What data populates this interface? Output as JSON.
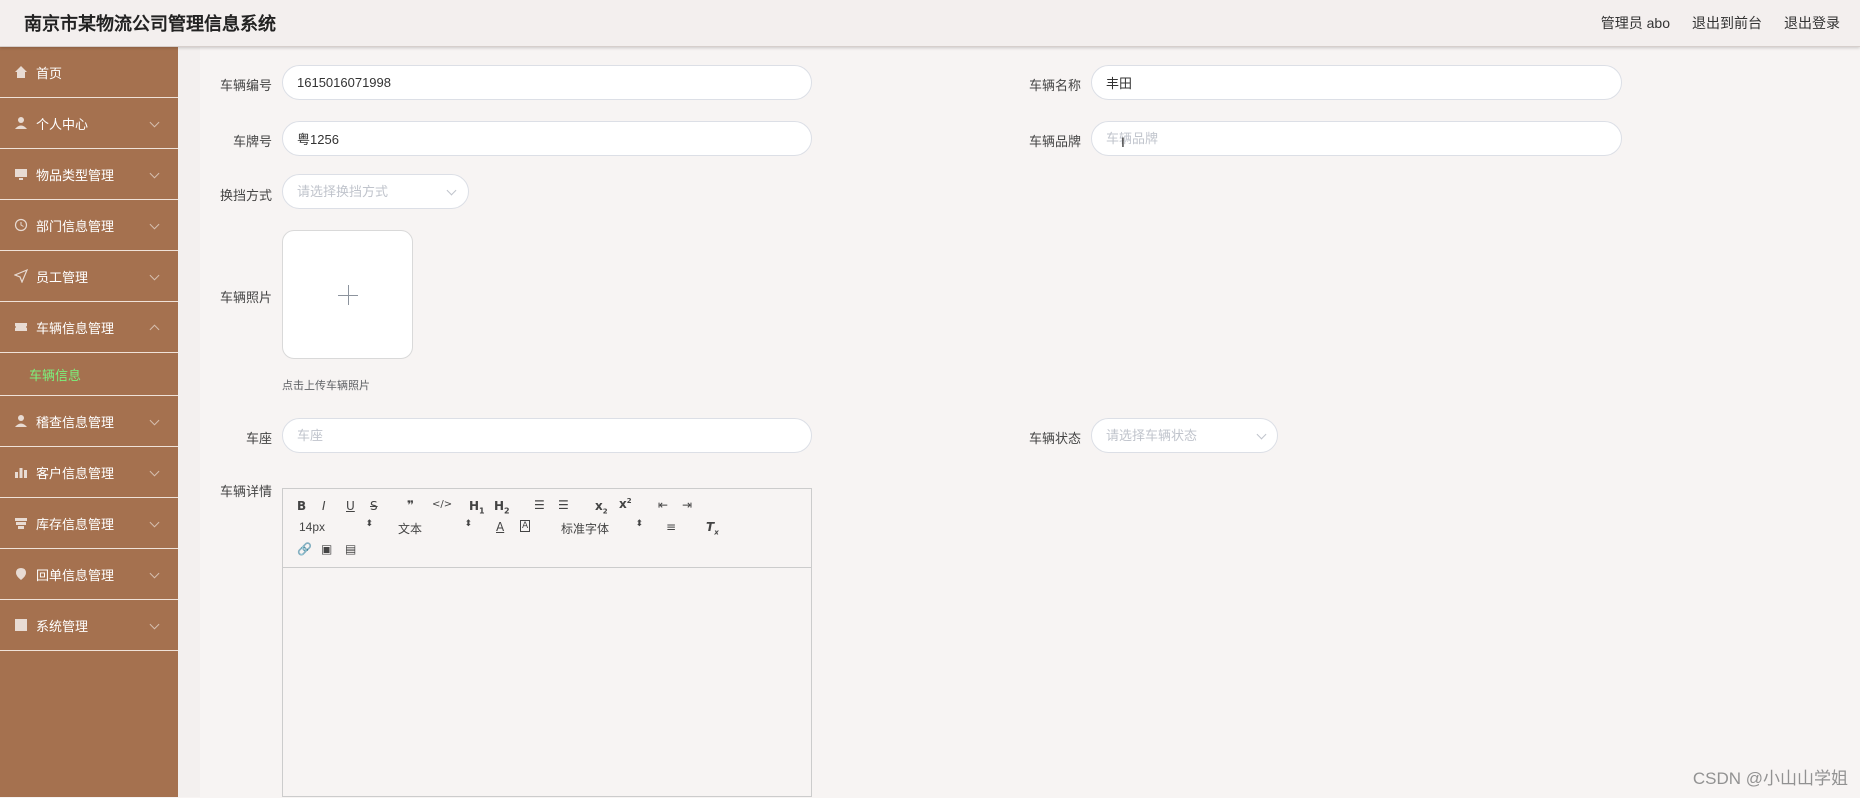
{
  "app": {
    "title": "南京市某物流公司管理信息系统",
    "nav": {
      "admin": "管理员 abo",
      "front": "退出到前台",
      "logout": "退出登录"
    }
  },
  "sidebar": {
    "items": [
      {
        "label": "首页",
        "icon": "home-icon",
        "chevron": false
      },
      {
        "label": "个人中心",
        "icon": "user-icon",
        "chevron": true
      },
      {
        "label": "物品类型管理",
        "icon": "monitor-icon",
        "chevron": true
      },
      {
        "label": "部门信息管理",
        "icon": "clock-icon",
        "chevron": true
      },
      {
        "label": "员工管理",
        "icon": "send-icon",
        "chevron": true
      },
      {
        "label": "车辆信息管理",
        "icon": "ticket-icon",
        "chevron": true,
        "expanded": true
      },
      {
        "label": "稽查信息管理",
        "icon": "person-icon",
        "chevron": true
      },
      {
        "label": "客户信息管理",
        "icon": "bar-chart-icon",
        "chevron": true
      },
      {
        "label": "库存信息管理",
        "icon": "stack-icon",
        "chevron": true
      },
      {
        "label": "回单信息管理",
        "icon": "location-icon",
        "chevron": true
      },
      {
        "label": "系统管理",
        "icon": "grid-icon",
        "chevron": true
      }
    ],
    "submenu": {
      "label": "车辆信息"
    }
  },
  "form": {
    "vehicle_no": {
      "label": "车辆编号",
      "value": "1615016071998"
    },
    "vehicle_name": {
      "label": "车辆名称",
      "value": "丰田"
    },
    "plate": {
      "label": "车牌号",
      "value": "粤1256"
    },
    "brand": {
      "label": "车辆品牌",
      "value": "",
      "placeholder": "车辆品牌"
    },
    "gear": {
      "label": "换挡方式",
      "placeholder": "请选择换挡方式"
    },
    "photo": {
      "label": "车辆照片",
      "tip": "点击上传车辆照片"
    },
    "seats": {
      "label": "车座",
      "placeholder": "车座"
    },
    "status": {
      "label": "车辆状态",
      "placeholder": "请选择车辆状态"
    },
    "detail": {
      "label": "车辆详情"
    }
  },
  "editor": {
    "font_size": "14px",
    "text_type": "文本",
    "font_family": "标准字体"
  },
  "watermark": "CSDN @小山山学姐",
  "colors": {
    "sidebar": "#a5714f",
    "active_sub": "#7cf07c"
  }
}
